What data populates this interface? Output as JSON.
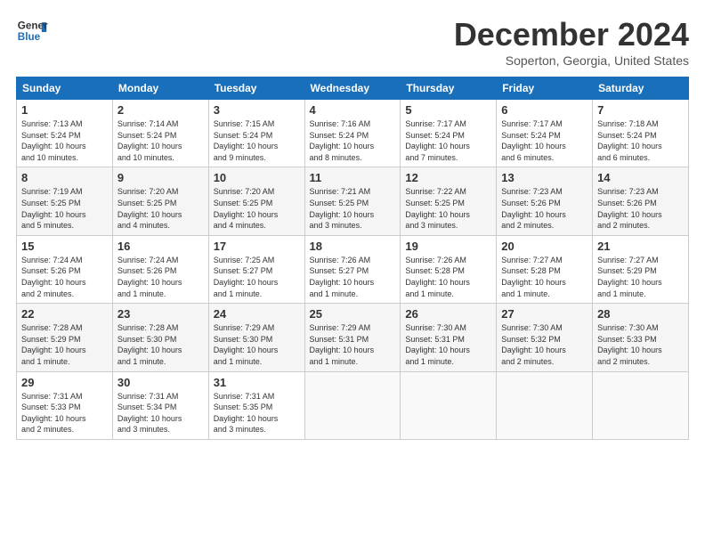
{
  "logo": {
    "line1": "General",
    "line2": "Blue"
  },
  "title": "December 2024",
  "subtitle": "Soperton, Georgia, United States",
  "days_of_week": [
    "Sunday",
    "Monday",
    "Tuesday",
    "Wednesday",
    "Thursday",
    "Friday",
    "Saturday"
  ],
  "weeks": [
    [
      {
        "day": "1",
        "info": "Sunrise: 7:13 AM\nSunset: 5:24 PM\nDaylight: 10 hours\nand 10 minutes."
      },
      {
        "day": "2",
        "info": "Sunrise: 7:14 AM\nSunset: 5:24 PM\nDaylight: 10 hours\nand 10 minutes."
      },
      {
        "day": "3",
        "info": "Sunrise: 7:15 AM\nSunset: 5:24 PM\nDaylight: 10 hours\nand 9 minutes."
      },
      {
        "day": "4",
        "info": "Sunrise: 7:16 AM\nSunset: 5:24 PM\nDaylight: 10 hours\nand 8 minutes."
      },
      {
        "day": "5",
        "info": "Sunrise: 7:17 AM\nSunset: 5:24 PM\nDaylight: 10 hours\nand 7 minutes."
      },
      {
        "day": "6",
        "info": "Sunrise: 7:17 AM\nSunset: 5:24 PM\nDaylight: 10 hours\nand 6 minutes."
      },
      {
        "day": "7",
        "info": "Sunrise: 7:18 AM\nSunset: 5:24 PM\nDaylight: 10 hours\nand 6 minutes."
      }
    ],
    [
      {
        "day": "8",
        "info": "Sunrise: 7:19 AM\nSunset: 5:25 PM\nDaylight: 10 hours\nand 5 minutes."
      },
      {
        "day": "9",
        "info": "Sunrise: 7:20 AM\nSunset: 5:25 PM\nDaylight: 10 hours\nand 4 minutes."
      },
      {
        "day": "10",
        "info": "Sunrise: 7:20 AM\nSunset: 5:25 PM\nDaylight: 10 hours\nand 4 minutes."
      },
      {
        "day": "11",
        "info": "Sunrise: 7:21 AM\nSunset: 5:25 PM\nDaylight: 10 hours\nand 3 minutes."
      },
      {
        "day": "12",
        "info": "Sunrise: 7:22 AM\nSunset: 5:25 PM\nDaylight: 10 hours\nand 3 minutes."
      },
      {
        "day": "13",
        "info": "Sunrise: 7:23 AM\nSunset: 5:26 PM\nDaylight: 10 hours\nand 2 minutes."
      },
      {
        "day": "14",
        "info": "Sunrise: 7:23 AM\nSunset: 5:26 PM\nDaylight: 10 hours\nand 2 minutes."
      }
    ],
    [
      {
        "day": "15",
        "info": "Sunrise: 7:24 AM\nSunset: 5:26 PM\nDaylight: 10 hours\nand 2 minutes."
      },
      {
        "day": "16",
        "info": "Sunrise: 7:24 AM\nSunset: 5:26 PM\nDaylight: 10 hours\nand 1 minute."
      },
      {
        "day": "17",
        "info": "Sunrise: 7:25 AM\nSunset: 5:27 PM\nDaylight: 10 hours\nand 1 minute."
      },
      {
        "day": "18",
        "info": "Sunrise: 7:26 AM\nSunset: 5:27 PM\nDaylight: 10 hours\nand 1 minute."
      },
      {
        "day": "19",
        "info": "Sunrise: 7:26 AM\nSunset: 5:28 PM\nDaylight: 10 hours\nand 1 minute."
      },
      {
        "day": "20",
        "info": "Sunrise: 7:27 AM\nSunset: 5:28 PM\nDaylight: 10 hours\nand 1 minute."
      },
      {
        "day": "21",
        "info": "Sunrise: 7:27 AM\nSunset: 5:29 PM\nDaylight: 10 hours\nand 1 minute."
      }
    ],
    [
      {
        "day": "22",
        "info": "Sunrise: 7:28 AM\nSunset: 5:29 PM\nDaylight: 10 hours\nand 1 minute."
      },
      {
        "day": "23",
        "info": "Sunrise: 7:28 AM\nSunset: 5:30 PM\nDaylight: 10 hours\nand 1 minute."
      },
      {
        "day": "24",
        "info": "Sunrise: 7:29 AM\nSunset: 5:30 PM\nDaylight: 10 hours\nand 1 minute."
      },
      {
        "day": "25",
        "info": "Sunrise: 7:29 AM\nSunset: 5:31 PM\nDaylight: 10 hours\nand 1 minute."
      },
      {
        "day": "26",
        "info": "Sunrise: 7:30 AM\nSunset: 5:31 PM\nDaylight: 10 hours\nand 1 minute."
      },
      {
        "day": "27",
        "info": "Sunrise: 7:30 AM\nSunset: 5:32 PM\nDaylight: 10 hours\nand 2 minutes."
      },
      {
        "day": "28",
        "info": "Sunrise: 7:30 AM\nSunset: 5:33 PM\nDaylight: 10 hours\nand 2 minutes."
      }
    ],
    [
      {
        "day": "29",
        "info": "Sunrise: 7:31 AM\nSunset: 5:33 PM\nDaylight: 10 hours\nand 2 minutes."
      },
      {
        "day": "30",
        "info": "Sunrise: 7:31 AM\nSunset: 5:34 PM\nDaylight: 10 hours\nand 3 minutes."
      },
      {
        "day": "31",
        "info": "Sunrise: 7:31 AM\nSunset: 5:35 PM\nDaylight: 10 hours\nand 3 minutes."
      },
      {
        "day": "",
        "info": ""
      },
      {
        "day": "",
        "info": ""
      },
      {
        "day": "",
        "info": ""
      },
      {
        "day": "",
        "info": ""
      }
    ]
  ]
}
